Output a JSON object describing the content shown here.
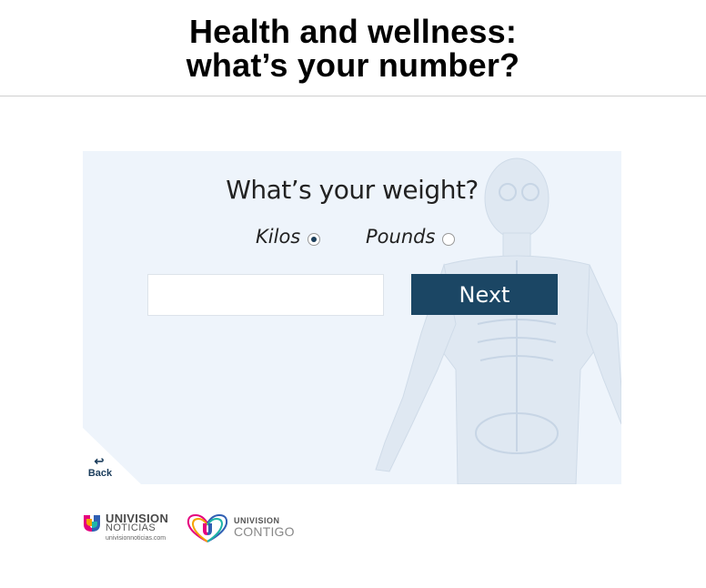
{
  "header": {
    "title_line1": "Health and wellness:",
    "title_line2": "what’s your number?"
  },
  "form": {
    "question": "What’s your weight?",
    "units": [
      {
        "label": "Kilos",
        "selected": true
      },
      {
        "label": "Pounds",
        "selected": false
      }
    ],
    "weight_value": "",
    "next_label": "Next",
    "back_label": "Back"
  },
  "footer": {
    "logo1_brand": "UNIVISION",
    "logo1_sub": "NOTICIAS",
    "logo1_url": "univisionnoticias.com",
    "logo2_brand": "UNIVISION",
    "logo2_sub": "CONTIGO"
  },
  "colors": {
    "accent": "#1b4664",
    "panel_bg": "#eef4fb"
  }
}
